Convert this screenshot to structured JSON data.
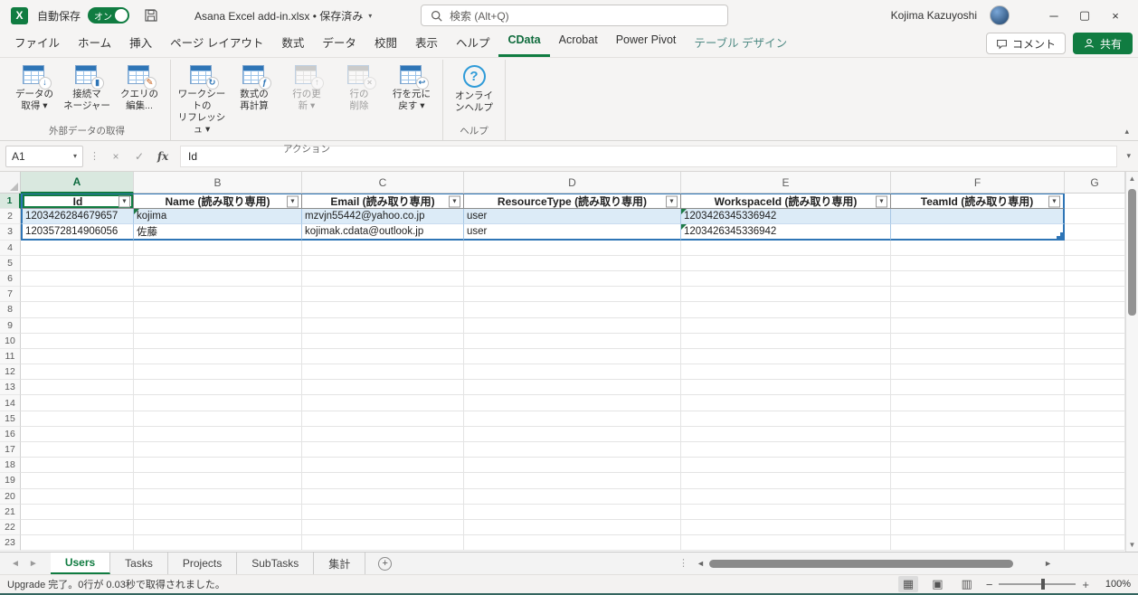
{
  "title_bar": {
    "autosave_label": "自動保存",
    "autosave_state": "オン",
    "document_title": "Asana Excel add-in.xlsx • 保存済み",
    "search_placeholder": "検索 (Alt+Q)",
    "user_name": "Kojima Kazuyoshi"
  },
  "colors": {
    "brand_green": "#107C41",
    "table_border_blue": "#2E75B6",
    "banded_row_blue": "#DCEBF7",
    "contextual_tab_teal": "#4F8A84",
    "error_flag_green": "#1D7A46"
  },
  "ribbon": {
    "tabs": [
      {
        "id": "file",
        "label": "ファイル"
      },
      {
        "id": "home",
        "label": "ホーム"
      },
      {
        "id": "insert",
        "label": "挿入"
      },
      {
        "id": "page-layout",
        "label": "ページ レイアウト"
      },
      {
        "id": "formulas",
        "label": "数式"
      },
      {
        "id": "data",
        "label": "データ"
      },
      {
        "id": "review",
        "label": "校閲"
      },
      {
        "id": "view",
        "label": "表示"
      },
      {
        "id": "help",
        "label": "ヘルプ"
      },
      {
        "id": "cdata",
        "label": "CData",
        "active": true
      },
      {
        "id": "acrobat",
        "label": "Acrobat"
      },
      {
        "id": "power-pivot",
        "label": "Power Pivot"
      },
      {
        "id": "table-design",
        "label": "テーブル デザイン",
        "contextual": true
      }
    ],
    "comment_label": "コメント",
    "share_label": "共有",
    "groups": [
      {
        "id": "get-external-data",
        "label": "外部データの取得",
        "buttons": [
          {
            "id": "get-data",
            "line1": "データの",
            "line2": "取得",
            "dropdown": true,
            "icon": "table-download-icon"
          },
          {
            "id": "connection-manager",
            "line1": "接続マ",
            "line2": "ネージャー",
            "icon": "connection-manager-icon"
          },
          {
            "id": "edit-query",
            "line1": "クエリの",
            "line2": "編集...",
            "icon": "query-edit-icon"
          }
        ]
      },
      {
        "id": "actions",
        "label": "アクション",
        "buttons": [
          {
            "id": "refresh-worksheet",
            "line1": "ワークシートの",
            "line2": "リフレッシュ",
            "dropdown": true,
            "icon": "worksheet-refresh-icon"
          },
          {
            "id": "recalculate-formulas",
            "line1": "数式の",
            "line2": "再計算",
            "icon": "recalculate-icon"
          },
          {
            "id": "update-rows",
            "line1": "行の更",
            "line2": "新",
            "dropdown": true,
            "disabled": true,
            "icon": "row-update-icon"
          },
          {
            "id": "delete-rows",
            "line1": "行の",
            "line2": "削除",
            "disabled": true,
            "icon": "row-delete-icon"
          },
          {
            "id": "revert-rows",
            "line1": "行を元に",
            "line2": "戻す",
            "dropdown": true,
            "icon": "row-undo-icon"
          }
        ]
      },
      {
        "id": "help",
        "label": "ヘルプ",
        "buttons": [
          {
            "id": "online-help",
            "line1": "オンライ",
            "line2": "ンヘルプ",
            "icon": "online-help-icon"
          }
        ]
      }
    ]
  },
  "formula_bar": {
    "name_box": "A1",
    "content": "Id"
  },
  "grid": {
    "columns": [
      "A",
      "B",
      "C",
      "D",
      "E",
      "F",
      "G"
    ],
    "visible_rows": 23,
    "headers": [
      "Id",
      "Name (読み取り専用)",
      "Email (読み取り専用)",
      "ResourceType (読み取り専用)",
      "WorkspaceId (読み取り専用)",
      "TeamId (読み取り専用)"
    ],
    "rows": [
      [
        "1203426284679657",
        "kojima",
        "mzvjn55442@yahoo.co.jp",
        "user",
        "1203426345336942",
        ""
      ],
      [
        "1203572814906056",
        "佐藤",
        "kojimak.cdata@outlook.jp",
        "user",
        "1203426345336942",
        ""
      ]
    ],
    "error_flags": [
      [
        2,
        "B"
      ],
      [
        2,
        "E"
      ],
      [
        3,
        "E"
      ]
    ],
    "selected_cell": "A1"
  },
  "sheet_tabs": {
    "active": "Users",
    "tabs": [
      "Users",
      "Tasks",
      "Projects",
      "SubTasks",
      "集計"
    ]
  },
  "status_bar": {
    "message": "Upgrade 完了。0行が 0.03秒で取得されました。",
    "zoom_level": "100%"
  }
}
